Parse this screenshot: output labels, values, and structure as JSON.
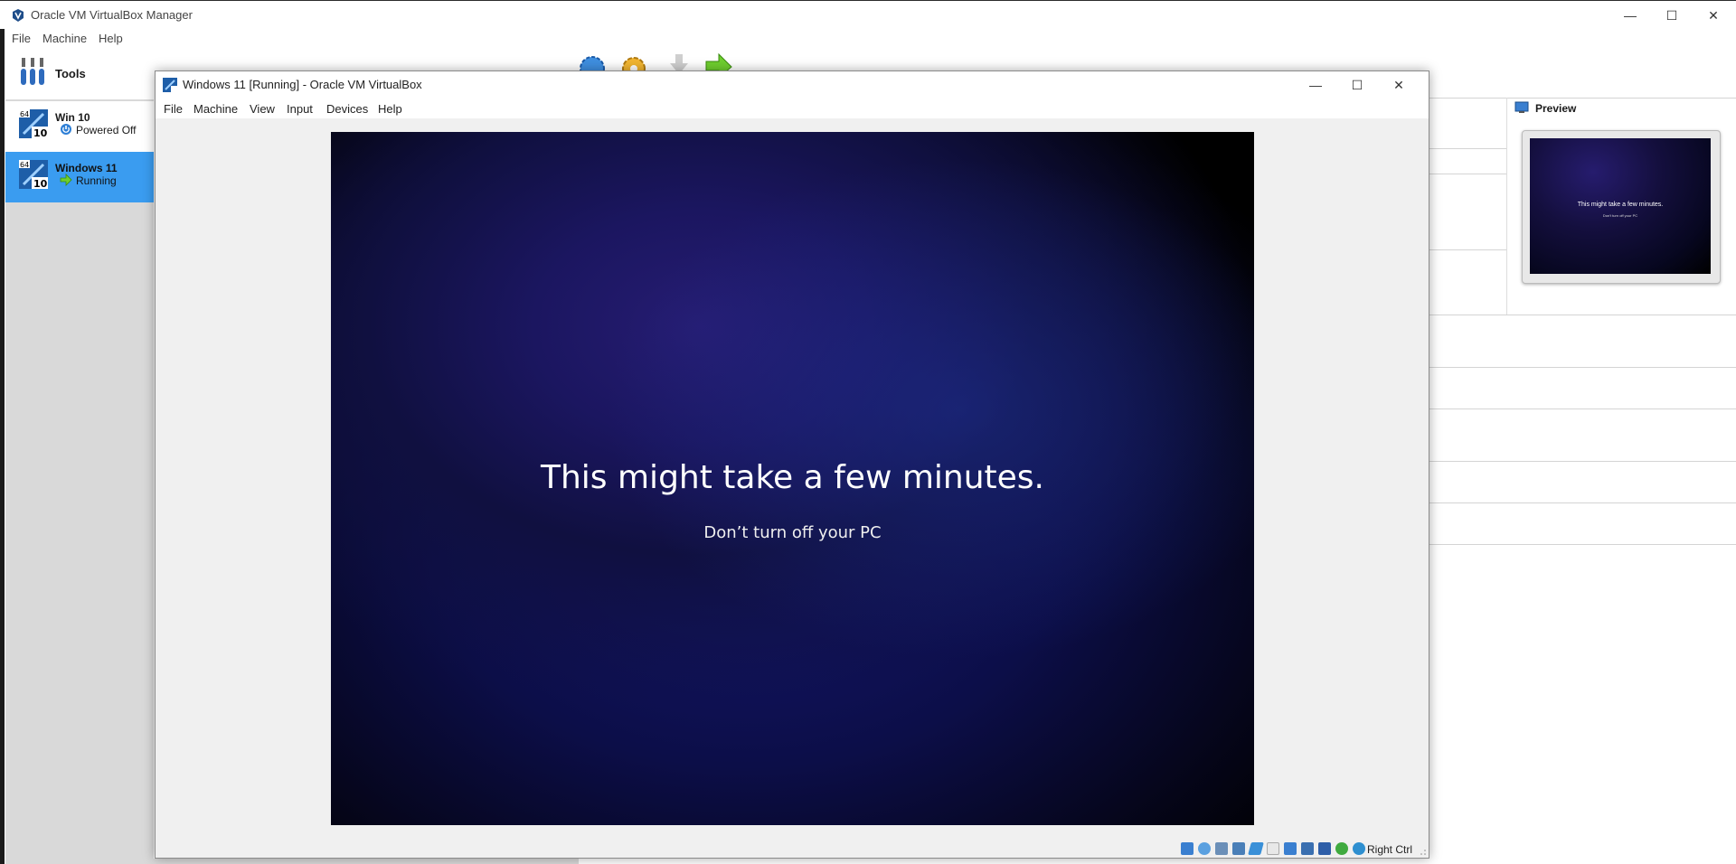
{
  "manager": {
    "title": "Oracle VM VirtualBox Manager",
    "menu": [
      "File",
      "Machine",
      "Help"
    ],
    "window_controls": {
      "minimize": "—",
      "maximize": "☐",
      "close": "✕"
    },
    "tools_label": "Tools",
    "vms": [
      {
        "name": "Win 10",
        "state": "Powered Off",
        "badge": "10"
      },
      {
        "name": "Windows 11",
        "state": "Running",
        "badge": "10"
      }
    ],
    "preview": {
      "title": "Preview",
      "main_text": "This might take a few minutes.",
      "sub_text": "Don't turn off your PC"
    }
  },
  "vm_window": {
    "title": "Windows 11 [Running] - Oracle VM VirtualBox",
    "menu": [
      "File",
      "Machine",
      "View",
      "Input",
      "Devices",
      "Help"
    ],
    "window_controls": {
      "minimize": "—",
      "maximize": "☐",
      "close": "✕"
    },
    "guest": {
      "main_text": "This might take a few minutes.",
      "sub_text": "Don’t turn off your PC"
    },
    "host_key": "Right Ctrl"
  },
  "colors": {
    "selection": "#3a9cf0",
    "guest_bg": "#0c0e48"
  }
}
